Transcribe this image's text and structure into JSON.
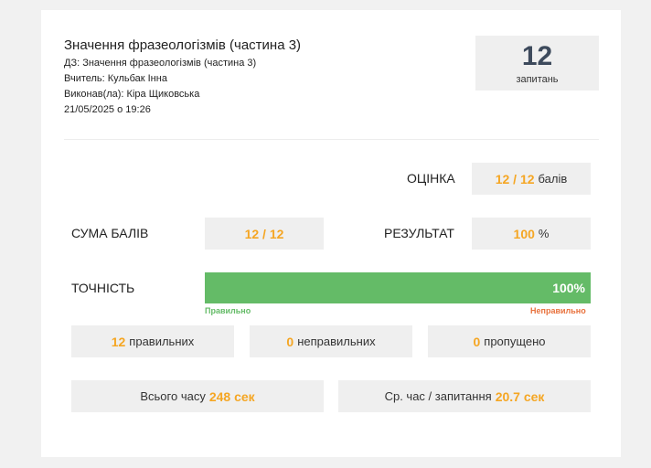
{
  "header": {
    "title": "Значення фразеологізмів (частина 3)",
    "homework": "ДЗ: Значення фразеологізмів (частина 3)",
    "teacher": "Вчитель: Кульбак Інна",
    "student": "Виконав(ла): Кіра Щиковська",
    "datetime": "21/05/2025 о 19:26"
  },
  "questions": {
    "count": "12",
    "label": "запитань"
  },
  "grade": {
    "label": "ОЦІНКА",
    "value": "12 / 12",
    "unit": "балів"
  },
  "score_sum": {
    "label": "СУМА БАЛІВ",
    "value": "12 / 12"
  },
  "result": {
    "label": "РЕЗУЛЬТАТ",
    "value": "100",
    "unit": "%"
  },
  "accuracy": {
    "label": "ТОЧНІСТЬ",
    "percent_text": "100%",
    "fraction": 1.0,
    "correct_label": "Правильно",
    "incorrect_label": "Неправильно",
    "colors": {
      "correct": "#64bb67",
      "incorrect": "#e8713c"
    }
  },
  "stats": {
    "correct": {
      "value": "12",
      "label": "правильних"
    },
    "incorrect": {
      "value": "0",
      "label": "неправильних"
    },
    "skipped": {
      "value": "0",
      "label": "пропущено"
    }
  },
  "time": {
    "total_label": "Всього часу",
    "total_value": "248 сек",
    "avg_label": "Ср. час / запитання",
    "avg_value": "20.7 сек"
  },
  "accent_color": "#f5a623"
}
